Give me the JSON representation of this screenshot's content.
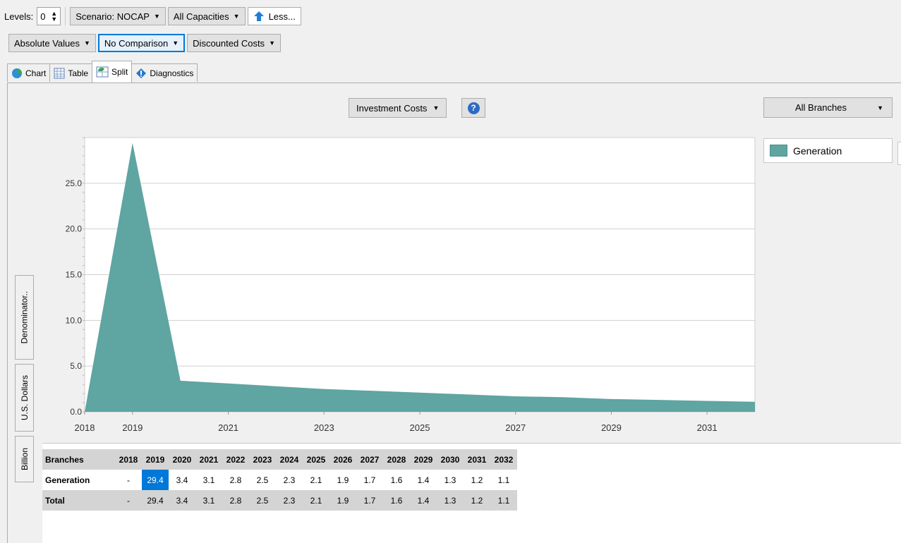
{
  "toolbar": {
    "levels_label": "Levels:",
    "levels_value": "0",
    "scenario": "Scenario: NOCAP",
    "capacities": "All Capacities",
    "less": "Less...",
    "values": "Absolute Values",
    "comparison": "No Comparison",
    "costs": "Discounted Costs"
  },
  "tabs": [
    {
      "label": "Chart",
      "icon": "pie-chart-icon"
    },
    {
      "label": "Table",
      "icon": "table-icon"
    },
    {
      "label": "Split",
      "icon": "split-view-icon",
      "active": true
    },
    {
      "label": "Diagnostics",
      "icon": "diagnostics-icon"
    }
  ],
  "chart_controls": {
    "metric": "Investment Costs",
    "help": "?",
    "branches": "All Branches"
  },
  "side_tabs": {
    "denominator": "Denominator..",
    "currency": "U.S. Dollars",
    "unit": "Billion"
  },
  "legend": [
    {
      "name": "Generation",
      "color": "#5fa5a2"
    }
  ],
  "chart_data": {
    "type": "area",
    "x": [
      2018,
      2019,
      2020,
      2021,
      2022,
      2023,
      2024,
      2025,
      2026,
      2027,
      2028,
      2029,
      2030,
      2031,
      2032
    ],
    "series": [
      {
        "name": "Generation",
        "values": [
          0,
          29.4,
          3.4,
          3.1,
          2.8,
          2.5,
          2.3,
          2.1,
          1.9,
          1.7,
          1.6,
          1.4,
          1.3,
          1.2,
          1.1
        ]
      }
    ],
    "x_tick_labels": [
      "2018",
      "2019",
      "2021",
      "2023",
      "2025",
      "2027",
      "2029",
      "2031"
    ],
    "y_tick_labels": [
      "0.0",
      "5.0",
      "10.0",
      "15.0",
      "20.0",
      "25.0"
    ],
    "ylim": [
      0,
      30
    ],
    "xlim": [
      2018,
      2032
    ],
    "grid": true,
    "fill_color": "#5fa5a2"
  },
  "table": {
    "header_label": "Branches",
    "years": [
      "2018",
      "2019",
      "2020",
      "2021",
      "2022",
      "2023",
      "2024",
      "2025",
      "2026",
      "2027",
      "2028",
      "2029",
      "2030",
      "2031",
      "2032"
    ],
    "rows": [
      {
        "name": "Generation",
        "values": [
          "-",
          "29.4",
          "3.4",
          "3.1",
          "2.8",
          "2.5",
          "2.3",
          "2.1",
          "1.9",
          "1.7",
          "1.6",
          "1.4",
          "1.3",
          "1.2",
          "1.1"
        ]
      }
    ],
    "total": {
      "name": "Total",
      "values": [
        "-",
        "29.4",
        "3.4",
        "3.1",
        "2.8",
        "2.5",
        "2.3",
        "2.1",
        "1.9",
        "1.7",
        "1.6",
        "1.4",
        "1.3",
        "1.2",
        "1.1"
      ]
    }
  }
}
